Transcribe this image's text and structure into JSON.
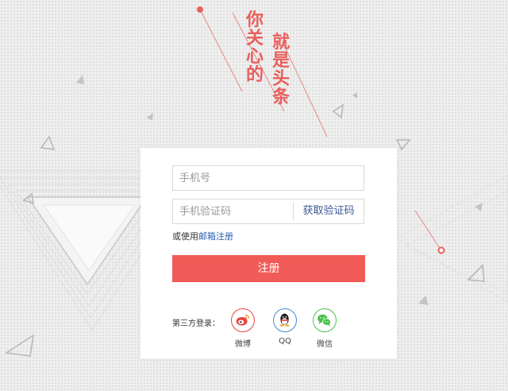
{
  "slogan": {
    "left_text": "你关心的",
    "right_text": "就是头条",
    "color": "#e95f5c"
  },
  "form": {
    "phone_placeholder": "手机号",
    "code_placeholder": "手机验证码",
    "get_code_label": "获取验证码",
    "alt_prefix": "或使用",
    "alt_link": "邮箱注册",
    "register_label": "注册",
    "accent_color": "#f15b57"
  },
  "third_party": {
    "label": "第三方登录：",
    "providers": [
      {
        "icon": "weibo-icon",
        "label": "微博",
        "color": "#e6443f"
      },
      {
        "icon": "qq-icon",
        "label": "QQ",
        "color": "#3f8bd8"
      },
      {
        "icon": "wechat-icon",
        "label": "微信",
        "color": "#4cbf4a"
      }
    ]
  }
}
